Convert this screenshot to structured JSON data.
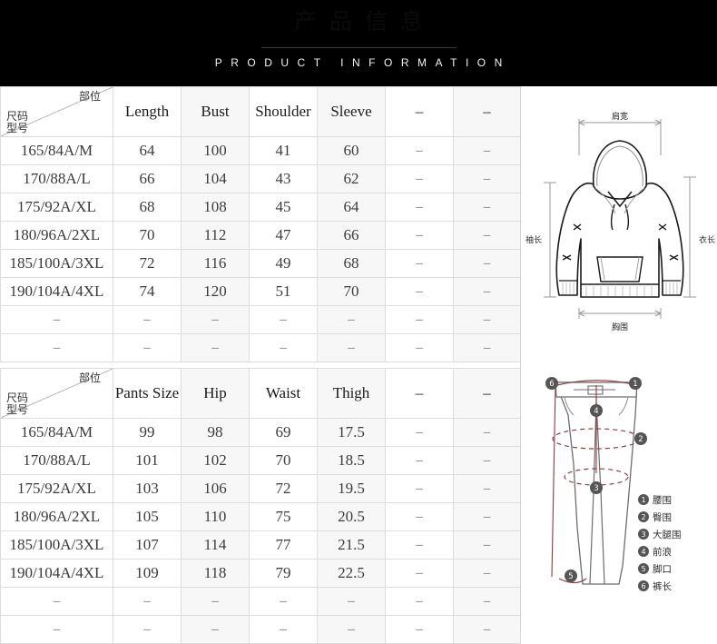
{
  "banner": {
    "cn_title": "产品信息",
    "en_title": "PRODUCT INFORMATION"
  },
  "corner": {
    "top_right": "部位",
    "bottom_left_line1": "尺码",
    "bottom_left_line2": "型号"
  },
  "table_top": {
    "headers": [
      "",
      "Length",
      "Bust",
      "Shoulder",
      "Sleeve",
      "–",
      "–"
    ],
    "rows": [
      [
        "165/84A/M",
        "64",
        "100",
        "41",
        "60",
        "–",
        "–"
      ],
      [
        "170/88A/L",
        "66",
        "104",
        "43",
        "62",
        "–",
        "–"
      ],
      [
        "175/92A/XL",
        "68",
        "108",
        "45",
        "64",
        "–",
        "–"
      ],
      [
        "180/96A/2XL",
        "70",
        "112",
        "47",
        "66",
        "–",
        "–"
      ],
      [
        "185/100A/3XL",
        "72",
        "116",
        "49",
        "68",
        "–",
        "–"
      ],
      [
        "190/104A/4XL",
        "74",
        "120",
        "51",
        "70",
        "–",
        "–"
      ],
      [
        "–",
        "–",
        "–",
        "–",
        "–",
        "–",
        "–"
      ],
      [
        "–",
        "–",
        "–",
        "–",
        "–",
        "–",
        "–"
      ]
    ]
  },
  "table_bottom": {
    "headers": [
      "",
      "Pants Size",
      "Hip",
      "Waist",
      "Thigh",
      "–",
      "–"
    ],
    "rows": [
      [
        "165/84A/M",
        "99",
        "98",
        "69",
        "17.5",
        "–",
        "–"
      ],
      [
        "170/88A/L",
        "101",
        "102",
        "70",
        "18.5",
        "–",
        "–"
      ],
      [
        "175/92A/XL",
        "103",
        "106",
        "72",
        "19.5",
        "–",
        "–"
      ],
      [
        "180/96A/2XL",
        "105",
        "110",
        "75",
        "20.5",
        "–",
        "–"
      ],
      [
        "185/100A/3XL",
        "107",
        "114",
        "77",
        "21.5",
        "–",
        "–"
      ],
      [
        "190/104A/4XL",
        "109",
        "118",
        "79",
        "22.5",
        "–",
        "–"
      ],
      [
        "–",
        "–",
        "–",
        "–",
        "–",
        "–",
        "–"
      ],
      [
        "–",
        "–",
        "–",
        "–",
        "–",
        "–",
        "–"
      ]
    ]
  },
  "hoodie_figure": {
    "label_shoulder": "肩宽",
    "label_sleeve": "袖长",
    "label_length": "衣长",
    "label_bust": "胸围"
  },
  "pants_figure": {
    "legend": [
      {
        "num": "1",
        "label": "腰围"
      },
      {
        "num": "2",
        "label": "臀围"
      },
      {
        "num": "3",
        "label": "大腿围"
      },
      {
        "num": "4",
        "label": "前浪"
      },
      {
        "num": "5",
        "label": "脚口"
      },
      {
        "num": "6",
        "label": "裤长"
      }
    ],
    "callouts": [
      "1",
      "2",
      "3",
      "4",
      "5",
      "6"
    ]
  },
  "colors": {
    "banner_bg": "#000000",
    "grid_line": "#dddddd",
    "alt_cell": "#f7f7f7",
    "text": "#3c3c3c",
    "pants_accent": "#8c3b42"
  }
}
